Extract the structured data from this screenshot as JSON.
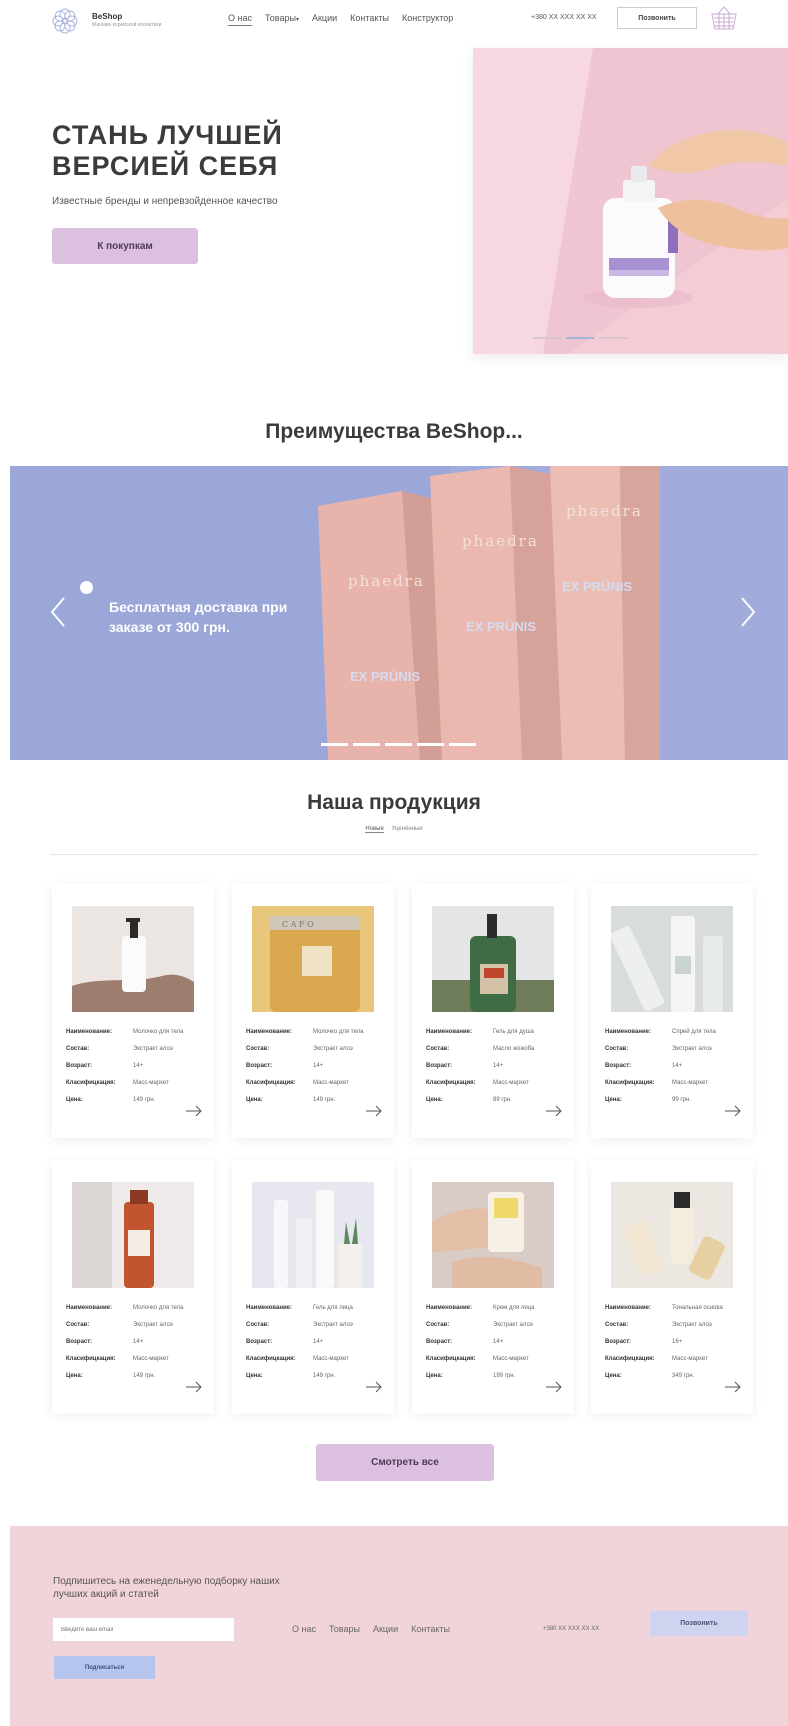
{
  "header": {
    "brand": "BeShop",
    "brand_sub": "Магазин корейской косметики",
    "nav": [
      "О нас",
      "Товары",
      "Акции",
      "Контакты",
      "Конструктор"
    ],
    "phone": "+380 XX XXX XX XX",
    "call_label": "Позвонить"
  },
  "hero": {
    "title": "СТАНЬ ЛУЧШЕЙ ВЕРСИЕЙ СЕБЯ",
    "subtitle": "Известные бренды и непревзойденное качество",
    "button": "К покупкам",
    "slide_count": 3,
    "active_slide": 2
  },
  "advantages": {
    "title": "Преимущества BeShop...",
    "slide_text": "Бесплатная доставка при заказе от 300 грн.",
    "box_brand": "phaedra",
    "box_product": "EX PRÜNIS",
    "slide_count": 5
  },
  "products": {
    "title": "Наша продукция",
    "tabs": [
      "Новые",
      "Уценённые"
    ],
    "labels": {
      "name": "Наименование:",
      "composition": "Состав:",
      "age": "Возраст:",
      "class": "Класифицкация:",
      "price": "Цена:"
    },
    "items": [
      {
        "name": "Молочко для тела",
        "composition": "Экстракт алоэ",
        "age": "14+",
        "class": "Масс-маркет",
        "price": "149 грн."
      },
      {
        "name": "Молочко для тела",
        "composition": "Экстракт алоэ",
        "age": "14+",
        "class": "Масс-маркет",
        "price": "149 грн."
      },
      {
        "name": "Гель для душа",
        "composition": "Масло жожоба",
        "age": "14+",
        "class": "Масс-маркет",
        "price": "89 грн."
      },
      {
        "name": "Спрей для тела",
        "composition": "Экстракт алоэ",
        "age": "14+",
        "class": "Масс-маркет",
        "price": "99 грн."
      },
      {
        "name": "Молочко для тела",
        "composition": "Экстракт алоэ",
        "age": "14+",
        "class": "Масс-маркет",
        "price": "149 грн."
      },
      {
        "name": "Гель для лица",
        "composition": "Экстракт алоэ",
        "age": "14+",
        "class": "Масс-маркет",
        "price": "149 грн."
      },
      {
        "name": "Крем для лица",
        "composition": "Экстракт алоэ",
        "age": "14+",
        "class": "Масс-маркет",
        "price": "199 грн."
      },
      {
        "name": "Тональная основа",
        "composition": "Экстракт алоэ",
        "age": "16+",
        "class": "Масс-маркет",
        "price": "349 грн."
      }
    ],
    "view_all": "Смотреть все"
  },
  "footer": {
    "subscribe_text": "Подпишитесь на еженедельную подборку наших лучших акций и статей",
    "email_placeholder": "Введите ваш email",
    "subscribe_button": "Подписаться",
    "nav": [
      "О нас",
      "Товары",
      "Акции",
      "Контакты"
    ],
    "phone": "+380 XX XXX XX XX",
    "call_label": "Позвонить"
  },
  "colors": {
    "accent_lilac": "#dcc0e0",
    "banner_blue": "#9ba7d8",
    "footer_pink": "#f1d4da",
    "footer_button_blue": "#b5c5ee"
  }
}
